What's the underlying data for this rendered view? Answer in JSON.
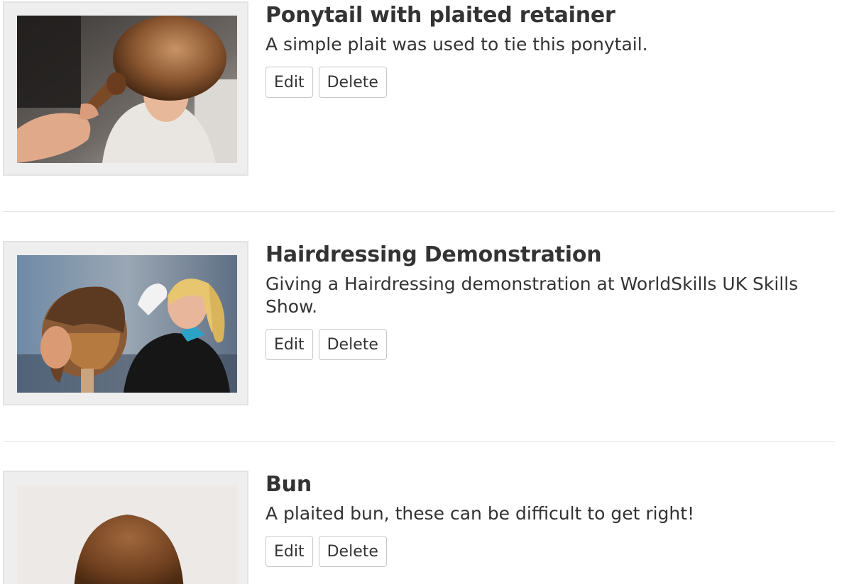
{
  "items": [
    {
      "title": "Ponytail with plaited retainer",
      "description": "A simple plait was used to tie this ponytail.",
      "edit_label": "Edit",
      "delete_label": "Delete",
      "image_alt": "Sleek low ponytail being tied with a plait"
    },
    {
      "title": "Hairdressing Demonstration",
      "description": "Giving a Hairdressing demonstration at WorldSkills UK Skills Show.",
      "edit_label": "Edit",
      "delete_label": "Delete",
      "image_alt": "Hairdresser working on a mannequin head"
    },
    {
      "title": "Bun",
      "description": "A plaited bun, these can be difficult to get right!",
      "edit_label": "Edit",
      "delete_label": "Delete",
      "image_alt": "Back of a head with sleek brown hair"
    }
  ],
  "colors": {
    "text": "#333333",
    "frame_bg": "#eeeeee",
    "button_border": "#c8c8c8",
    "divider": "#e6e6e6"
  }
}
